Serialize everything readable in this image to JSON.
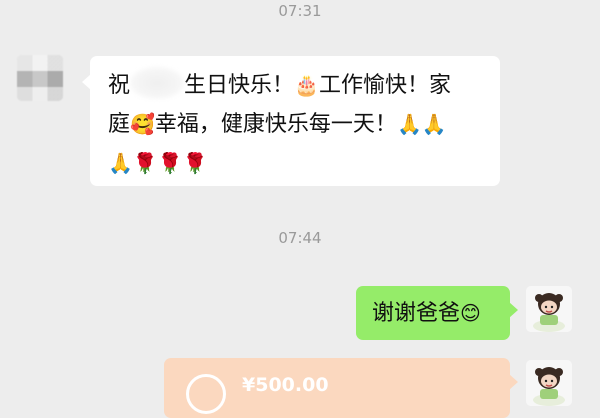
{
  "timestamps": [
    "07:31",
    "07:44"
  ],
  "messages": [
    {
      "side": "left",
      "line1_prefix": "祝",
      "line1_suffix": "生日快乐！",
      "line1_emoji": "🎂",
      "line1_tail": "工作愉快！家",
      "line2_start": "庭",
      "line2_emoji": "🥰",
      "line2_tail": "幸福，健康快乐每一天！",
      "line2_end_emoji": "🙏🙏",
      "line3_emoji": "🙏🌹🌹🌹"
    },
    {
      "side": "right",
      "text": "谢谢爸爸",
      "emoji": "😊"
    }
  ],
  "transfer": {
    "amount": "¥500.00"
  },
  "colors": {
    "background": "#ededed",
    "bubble_left": "#ffffff",
    "bubble_right": "#95ec69",
    "transfer": "#fbd8bf"
  }
}
